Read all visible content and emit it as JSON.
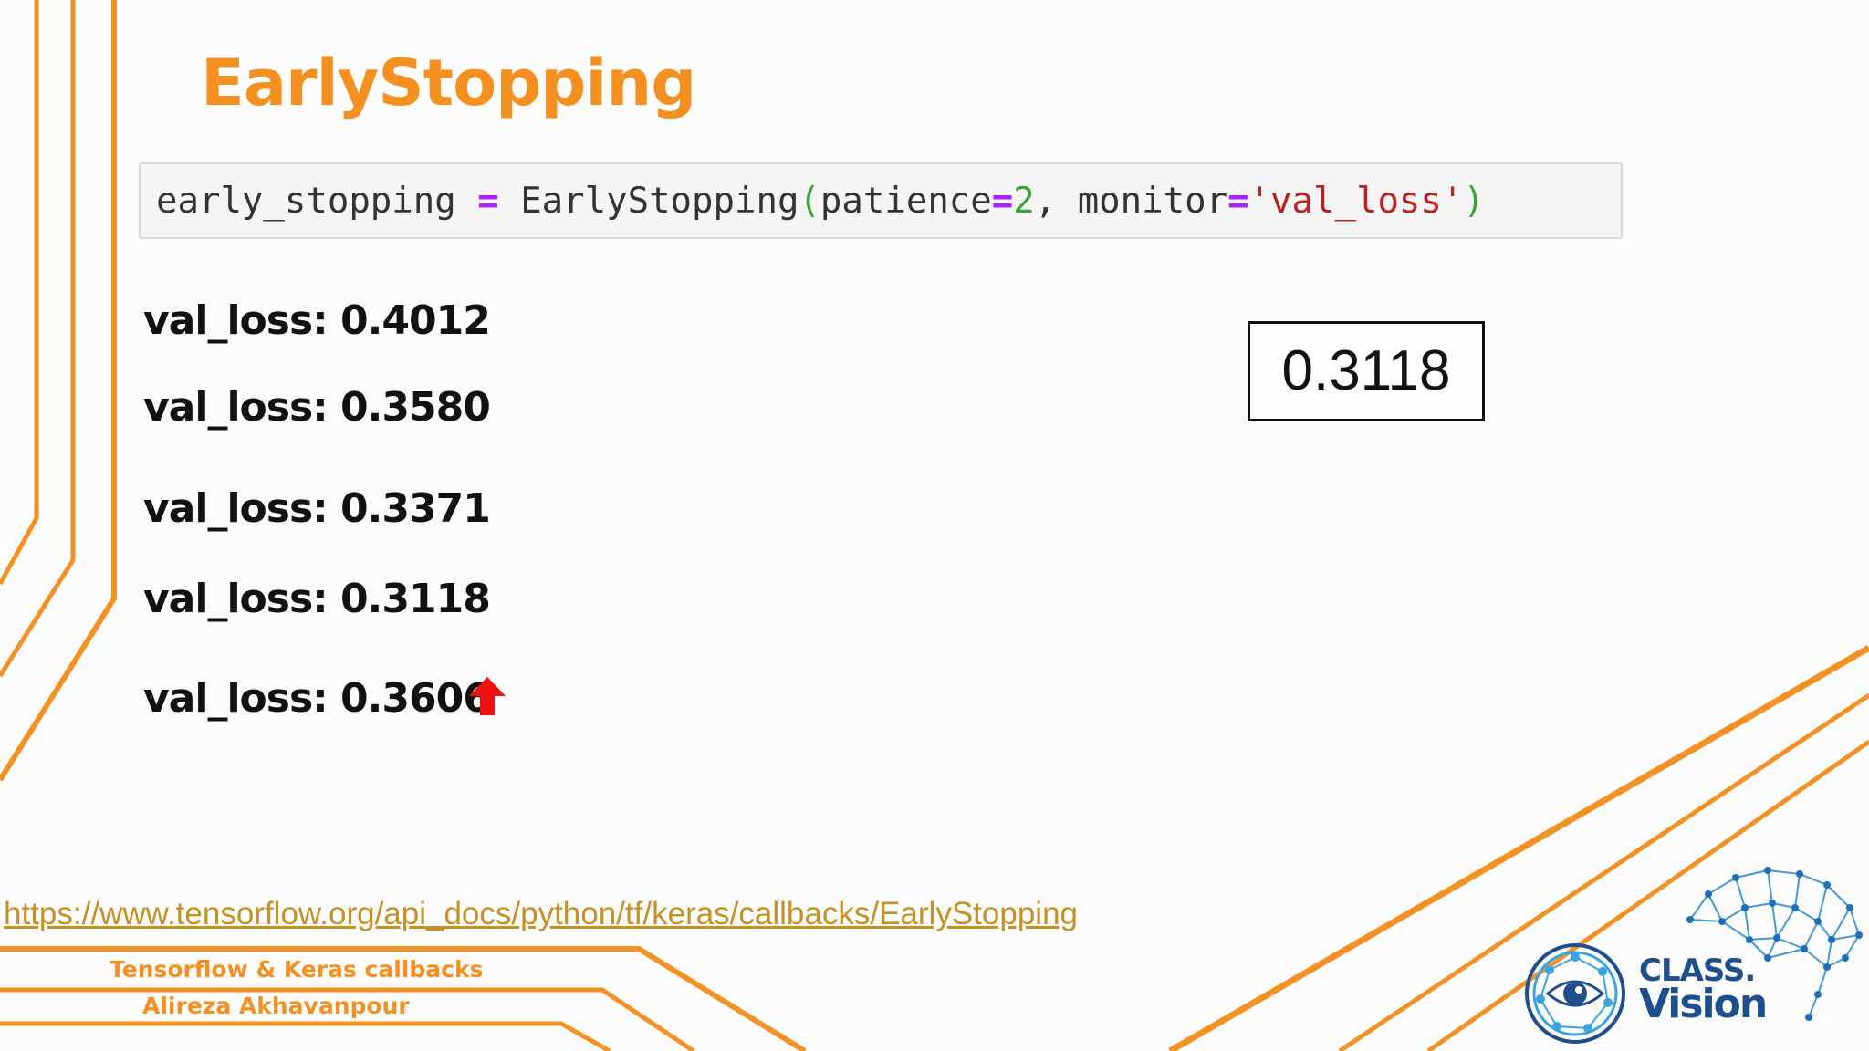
{
  "slide": {
    "title": "EarlyStopping",
    "code": {
      "var": "early_stopping",
      "eq1": "=",
      "func": "EarlyStopping",
      "open": "(",
      "arg1_name": "patience",
      "eq2": "=",
      "arg1_value": "2",
      "comma": ",",
      "arg2_name": "monitor",
      "eq3": "=",
      "arg2_value": "'val_loss'",
      "close": ")"
    },
    "val_losses": [
      "val_loss: 0.4012",
      "val_loss: 0.3580",
      "val_loss: 0.3371",
      "val_loss: 0.3118",
      "val_loss: 0.3606"
    ],
    "best_value": "0.3118",
    "link": "https://www.tensorflow.org/api_docs/python/tf/keras/callbacks/EarlyStopping",
    "footer": {
      "course": "Tensorflow & Keras callbacks",
      "author": "Alireza Akhavanpour"
    },
    "logo": {
      "line1": "CLASS.",
      "line2": "Vision"
    },
    "icons": {
      "increase": "arrow-up-icon",
      "logo_eye": "eye-icon",
      "logo_brain": "brain-network-icon"
    },
    "colors": {
      "accent": "#f49020",
      "link": "#c79023",
      "arrow": "#ee1111",
      "logo": "#1f4e8c"
    }
  }
}
